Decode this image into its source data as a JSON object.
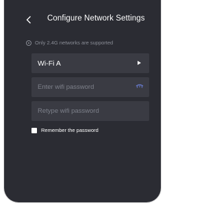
{
  "header": {
    "title": "Configure Network Settings",
    "back_icon": "chevron-left-icon"
  },
  "notice": {
    "text": "Only 2.4G networks are supported",
    "icon": "info-circle-icon"
  },
  "network_select": {
    "value": "Wi-Fi A",
    "icon": "play-arrow-icon"
  },
  "password": {
    "placeholder": "Enter wifi password",
    "icon": "eye-hidden-icon"
  },
  "retype": {
    "placeholder": "Retype wifi password"
  },
  "remember": {
    "label": "Remember the password",
    "checked": false
  },
  "colors": {
    "background": "#2b2c33",
    "field": "#3a3b43",
    "accent": "#6a7fd6"
  }
}
